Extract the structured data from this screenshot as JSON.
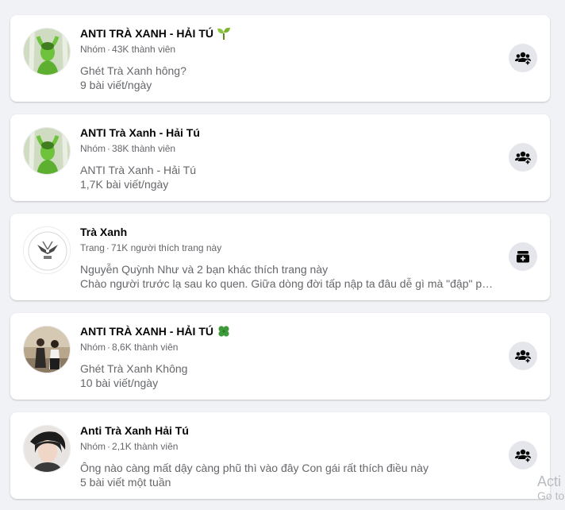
{
  "results": [
    {
      "title": "ANTI TRÀ XANH - HẢI TÚ",
      "title_emoji": "seedling-emoji",
      "type": "Nhóm",
      "stat": "43K thành viên",
      "lines": [
        "Ghét Trà Xanh hông?",
        "9 bài viết/ngày"
      ],
      "action_icon": "join-group-icon",
      "avatar": "green-figure-avatar"
    },
    {
      "title": "ANTI Trà Xanh - Hải Tú",
      "title_emoji": "",
      "type": "Nhóm",
      "stat": "38K thành viên",
      "lines": [
        "ANTI Trà Xanh - Hải Tú",
        "1,7K bài viết/ngày"
      ],
      "action_icon": "join-group-icon",
      "avatar": "green-figure-avatar"
    },
    {
      "title": "Trà Xanh",
      "title_emoji": "",
      "type": "Trang",
      "stat": "71K người thích trang này",
      "lines": [
        "Nguyễn Quỳnh Như và 2 bạn khác thích trang này",
        "Chào người trước lạ sau ko quen. Giữa dòng đời tấp nập ta đâu dễ gì mà \"đập\" phả..."
      ],
      "action_icon": "like-page-icon",
      "avatar": "logo-avatar"
    },
    {
      "title": "ANTI TRÀ XANH - HẢI TÚ",
      "title_emoji": "four-leaf-clover-emoji",
      "type": "Nhóm",
      "stat": "8,6K thành viên",
      "lines": [
        "Ghét Trà Xanh Không",
        "10 bài viết/ngày"
      ],
      "action_icon": "join-group-icon",
      "avatar": "couple-photo-avatar"
    },
    {
      "title": "Anti Trà Xanh Hải Tú",
      "title_emoji": "",
      "type": "Nhóm",
      "stat": "2,1K thành viên",
      "lines": [
        "Ông nào càng mất dậy càng phũ thì vào đây Con gái rất thích điều này",
        "5 bài viết một tuần"
      ],
      "action_icon": "join-group-icon",
      "avatar": "portrait-photo-avatar"
    }
  ],
  "watermark": {
    "line1": "Acti",
    "line2": "Go to"
  },
  "colors": {
    "background": "#f0f2f5",
    "card": "#ffffff",
    "secondary_text": "#65676b",
    "button_bg": "#e4e6eb"
  }
}
